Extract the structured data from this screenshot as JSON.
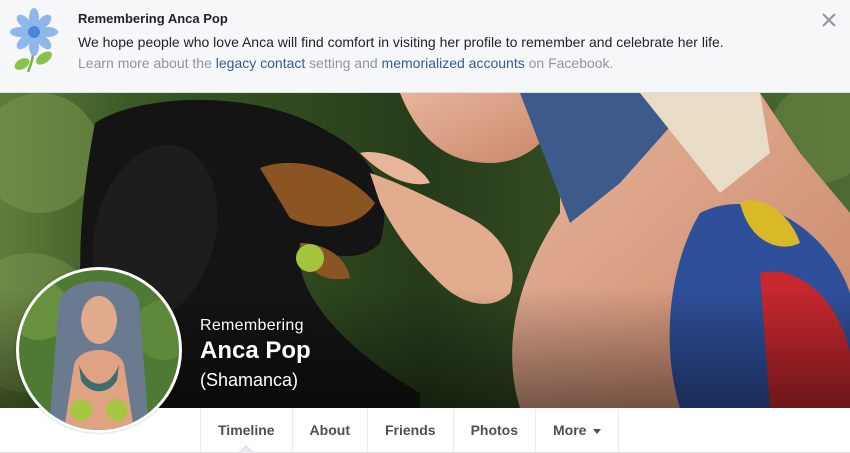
{
  "banner": {
    "title": "Remembering Anca Pop",
    "message": "We hope people who love Anca will find comfort in visiting her profile to remember and celebrate her life.",
    "learn_prefix": "Learn more about the ",
    "legacy_link": "legacy contact",
    "learn_middle": " setting and ",
    "memorialized_link": "memorialized accounts",
    "learn_suffix": " on Facebook."
  },
  "profile": {
    "remembering": "Remembering",
    "name": "Anca Pop",
    "alternate_name": "(Shamanca)"
  },
  "tabs": [
    {
      "label": "Timeline",
      "active": true
    },
    {
      "label": "About"
    },
    {
      "label": "Friends"
    },
    {
      "label": "Photos"
    },
    {
      "label": "More"
    }
  ],
  "colors": {
    "link": "#365899",
    "banner_bg": "#f6f7f9",
    "page_bg": "#e9ebee"
  }
}
